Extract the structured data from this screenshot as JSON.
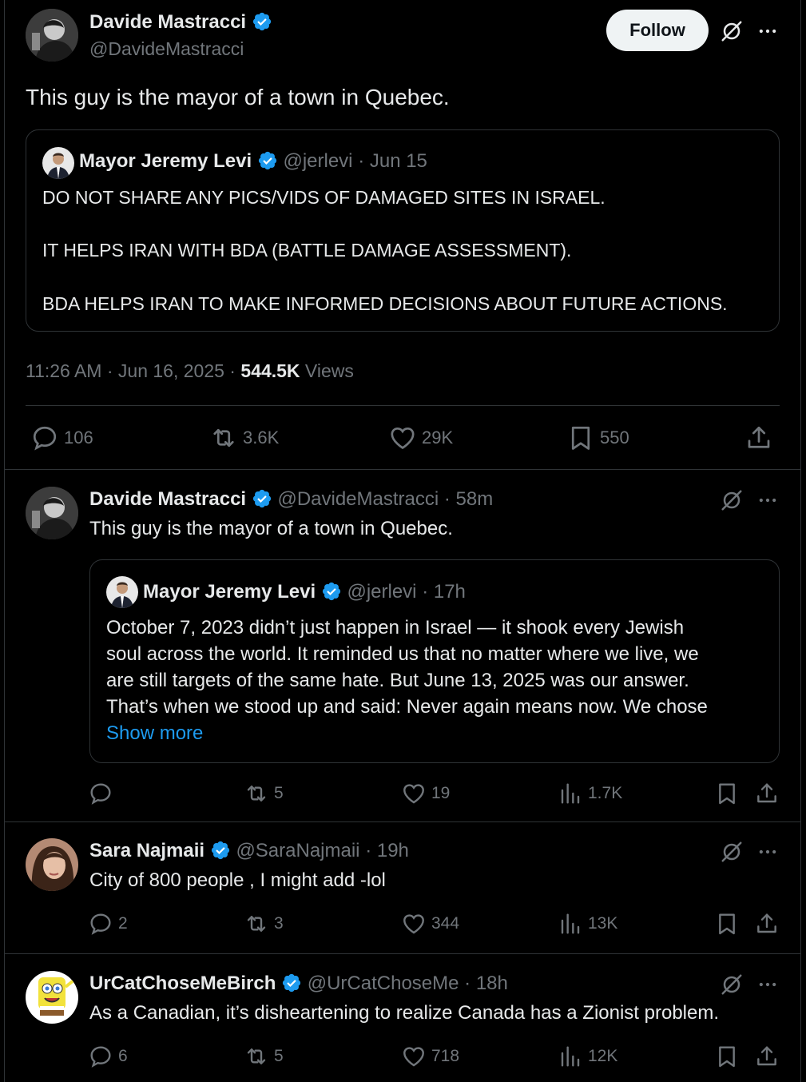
{
  "main": {
    "author": {
      "name": "Davide Mastracci",
      "handle": "@DavideMastracci"
    },
    "follow_label": "Follow",
    "text": "This guy is the mayor of a town in Quebec.",
    "quote": {
      "name": "Mayor Jeremy Levi",
      "handle": "@jerlevi",
      "date": "· Jun 15",
      "line1": "DO NOT SHARE ANY PICS/VIDS OF DAMAGED SITES IN ISRAEL.",
      "line2": "IT HELPS IRAN WITH BDA (BATTLE DAMAGE ASSESSMENT).",
      "line3": "BDA HELPS IRAN TO MAKE INFORMED DECISIONS ABOUT FUTURE ACTIONS."
    },
    "meta": {
      "time": "11:26 AM · Jun 16, 2025 ·",
      "views_count": "544.5K",
      "views_label": "Views"
    },
    "stats": {
      "replies": "106",
      "reposts": "3.6K",
      "likes": "29K",
      "bookmarks": "550"
    }
  },
  "replies": [
    {
      "name": "Davide Mastracci",
      "handle": "@DavideMastracci",
      "time": "· 58m",
      "text": "This guy is the mayor of a town in Quebec.",
      "quote": {
        "name": "Mayor Jeremy Levi",
        "handle": "@jerlevi",
        "time": "· 17h",
        "line1": "October 7, 2023 didn’t just happen in Israel — it shook every Jewish",
        "line2": "soul across the world. It reminded us that no matter where we live, we",
        "line3": "are still targets of the same hate. But June 13, 2025 was our answer.",
        "line4": "That’s when we stood up and said: Never again means now. We chose",
        "show_more": "Show more"
      },
      "stats": {
        "replies": "",
        "reposts": "5",
        "likes": "19",
        "views": "1.7K"
      }
    },
    {
      "name": "Sara Najmaii",
      "handle": "@SaraNajmaii",
      "time": "· 19h",
      "text": "City of 800 people , I might add -lol",
      "stats": {
        "replies": "2",
        "reposts": "3",
        "likes": "344",
        "views": "13K"
      }
    },
    {
      "name": "UrCatChoseMeBirch",
      "handle": "@UrCatChoseMe",
      "time": "· 18h",
      "text": "As a Canadian, it’s disheartening to realize Canada has a Zionist problem.",
      "stats": {
        "replies": "6",
        "reposts": "5",
        "likes": "718",
        "views": "12K"
      }
    }
  ],
  "colors": {
    "background": "#000000",
    "text": "#e7e9ea",
    "muted": "#71767b",
    "verified": "#1d9bf0",
    "link": "#1d9bf0",
    "divider": "#2f3336"
  }
}
